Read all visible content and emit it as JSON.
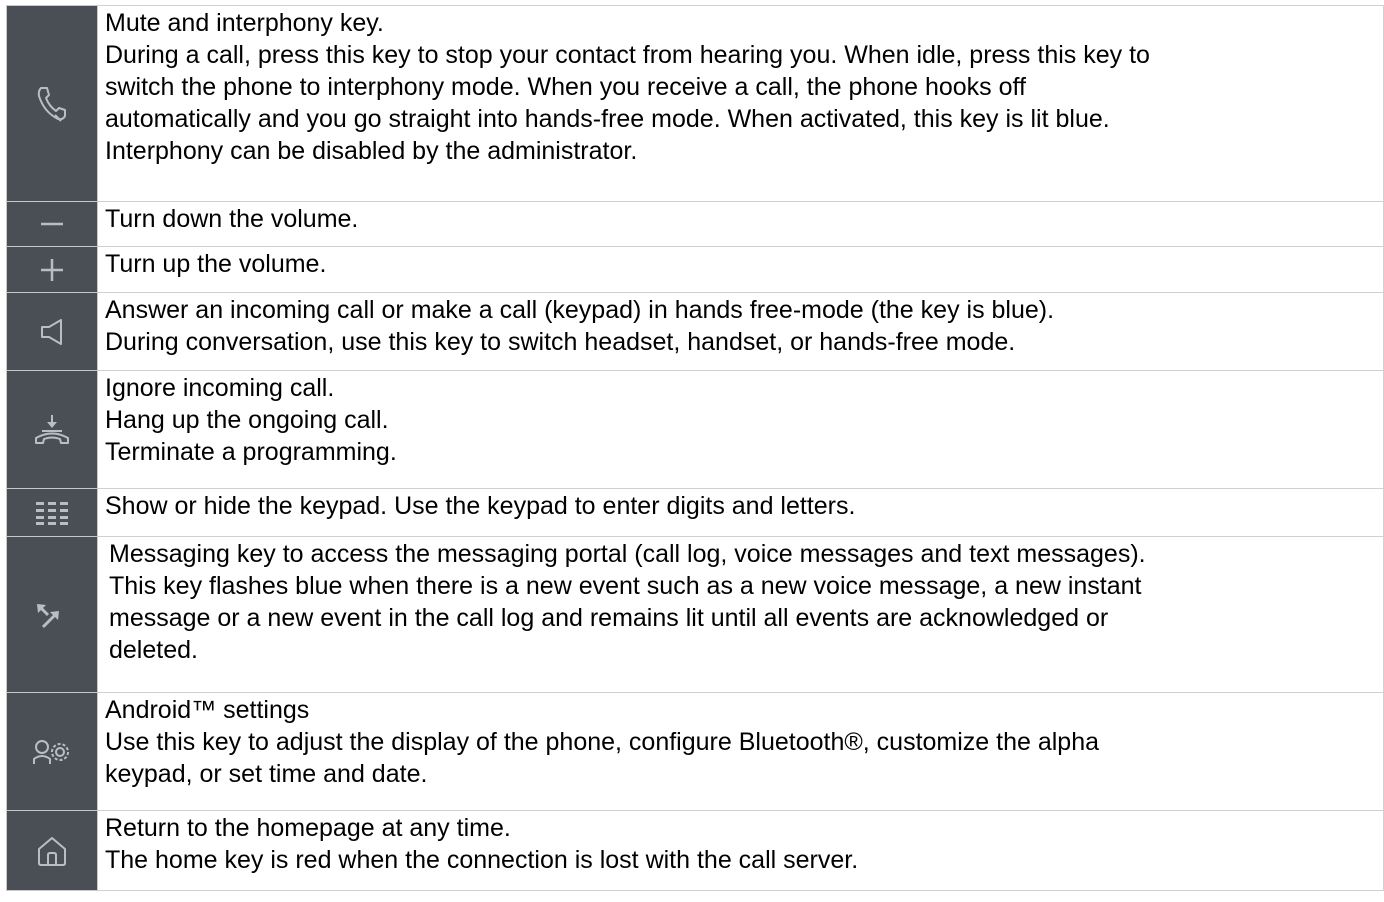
{
  "colors": {
    "icon_background": "#4a4f56",
    "icon_stroke": "#b9bec4",
    "border": "#d0d0d0",
    "text": "#000000"
  },
  "rows": [
    {
      "icon": "handset-icon",
      "lines": [
        "Mute and interphony key.",
        "During a call, press this key to stop your contact from hearing you. When idle, press this key to",
        "switch the phone to interphony mode. When you receive a call, the phone hooks off",
        "automatically and you go straight into hands-free mode. When activated, this key is lit blue.",
        "Interphony can be disabled by the administrator."
      ]
    },
    {
      "icon": "minus-icon",
      "lines": [
        "Turn down the volume."
      ]
    },
    {
      "icon": "plus-icon",
      "lines": [
        "Turn up the volume."
      ]
    },
    {
      "icon": "speaker-icon",
      "lines": [
        "Answer an incoming call or make a call (keypad) in hands free-mode (the key is blue).",
        "During conversation, use this key to switch headset, handset, or hands-free mode."
      ]
    },
    {
      "icon": "hang-up-icon",
      "lines": [
        "Ignore incoming call.",
        "Hang up the ongoing call.",
        "Terminate a programming."
      ]
    },
    {
      "icon": "keypad-icon",
      "lines": [
        "Show or hide the keypad. Use the keypad to enter digits and letters."
      ]
    },
    {
      "icon": "messaging-icon",
      "lines": [
        "Messaging key to access the messaging portal (call log, voice messages and text messages).",
        "This key flashes blue when there is a new event such as a new voice message, a new instant",
        "message or a new event in the call log and remains lit until all events are acknowledged or",
        "deleted."
      ]
    },
    {
      "icon": "settings-icon",
      "lines": [
        "Android™ settings",
        "Use this key to adjust the display of the phone, configure Bluetooth®, customize the alpha",
        "keypad, or set time and date."
      ]
    },
    {
      "icon": "home-icon",
      "lines": [
        "Return to the homepage at any time.",
        "The home key is red when the connection is lost with the call server."
      ]
    }
  ]
}
